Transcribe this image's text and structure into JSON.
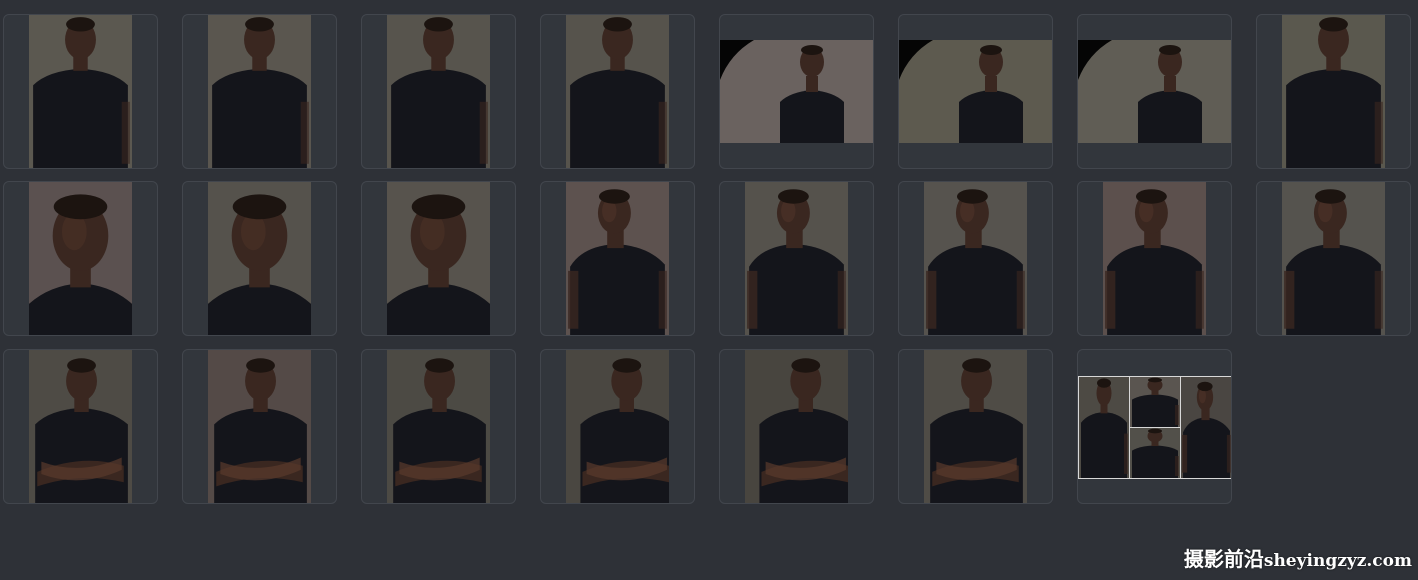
{
  "watermark": {
    "cjk": "摄影前沿",
    "latin": "sheyingzyz.com"
  },
  "colors": {
    "background": "#2e3137",
    "tile_border": "#42464d",
    "tile_fill": "#32363c"
  },
  "thumbnails": [
    {
      "pose": "standing-front",
      "backdrop": "#5b5850"
    },
    {
      "pose": "standing-front",
      "backdrop": "#5a564f"
    },
    {
      "pose": "standing-front",
      "backdrop": "#57544d"
    },
    {
      "pose": "standing-front",
      "backdrop": "#56534c"
    },
    {
      "pose": "wide-shot-with-light",
      "backdrop": "#6a625f"
    },
    {
      "pose": "wide-shot-with-light",
      "backdrop": "#5d5a4f"
    },
    {
      "pose": "wide-shot-with-light",
      "backdrop": "#605d55"
    },
    {
      "pose": "standing-front",
      "backdrop": "#5a584e"
    },
    {
      "pose": "close-up",
      "backdrop": "#5b5150"
    },
    {
      "pose": "close-up",
      "backdrop": "#55524c"
    },
    {
      "pose": "close-up",
      "backdrop": "#57534d"
    },
    {
      "pose": "three-quarter",
      "backdrop": "#5d524f"
    },
    {
      "pose": "three-quarter",
      "backdrop": "#55524c"
    },
    {
      "pose": "three-quarter",
      "backdrop": "#56534e"
    },
    {
      "pose": "three-quarter",
      "backdrop": "#5c504d"
    },
    {
      "pose": "three-quarter",
      "backdrop": "#55534e"
    },
    {
      "pose": "arms-crossed",
      "backdrop": "#4e4b45"
    },
    {
      "pose": "arms-crossed",
      "backdrop": "#544a47"
    },
    {
      "pose": "arms-crossed",
      "backdrop": "#4c4a44"
    },
    {
      "pose": "arms-crossed-lean",
      "backdrop": "#4a4741"
    },
    {
      "pose": "arms-crossed-lean",
      "backdrop": "#48453f"
    },
    {
      "pose": "arms-crossed",
      "backdrop": "#4f4c46"
    }
  ],
  "composite": {
    "label": "contact-sheet"
  }
}
